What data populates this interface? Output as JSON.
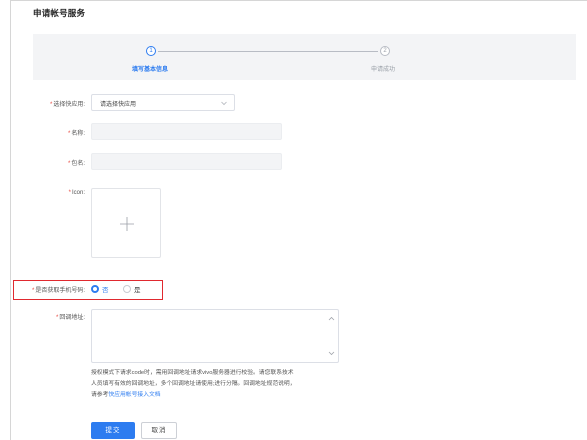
{
  "page": {
    "title": "申请帐号服务"
  },
  "steps": [
    {
      "number": "1",
      "label": "填写基本信息",
      "state": "active"
    },
    {
      "number": "2",
      "label": "申请成功",
      "state": "pending"
    }
  ],
  "form": {
    "quickapp": {
      "label": "选择快应用:",
      "required": "*",
      "value": "请选择快应用"
    },
    "name": {
      "label": "名称:",
      "required": "*",
      "value": ""
    },
    "package": {
      "label": "包名:",
      "required": "*",
      "value": ""
    },
    "icon": {
      "label": "Icon:",
      "required": "*"
    },
    "phone": {
      "label": "是否获取手机号码:",
      "required": "*",
      "options": [
        {
          "label": "否",
          "selected": true
        },
        {
          "label": "是",
          "selected": false
        }
      ]
    },
    "callback": {
      "label": "回调地址:",
      "required": "*",
      "value": ""
    },
    "help": {
      "line1": "授权模式下请求code时，需用回调地址请求vivo服务器进行校验。请您联系技术",
      "line2": "人员填写有效的回调地址，多个回调地址请使用;进行分隔。回调地址规范说明，",
      "line3_prefix": "请参考",
      "line3_link": "快应用帐号接入文档"
    }
  },
  "buttons": {
    "submit": "提交",
    "cancel": "取消"
  },
  "colors": {
    "accent": "#2d7cf0",
    "required": "#e8453c",
    "highlight": "#e0292f"
  }
}
